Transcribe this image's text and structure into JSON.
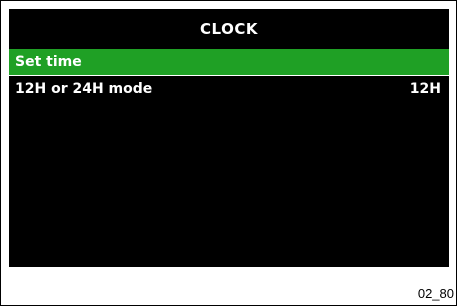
{
  "screen": {
    "title": "CLOCK",
    "menu": [
      {
        "label": "Set time",
        "value": "",
        "selected": true
      },
      {
        "label": "12H or 24H mode",
        "value": "12H",
        "selected": false
      }
    ]
  },
  "caption": "02_80",
  "colors": {
    "background": "#000000",
    "selected_highlight": "#1fa025",
    "text": "#ffffff"
  }
}
